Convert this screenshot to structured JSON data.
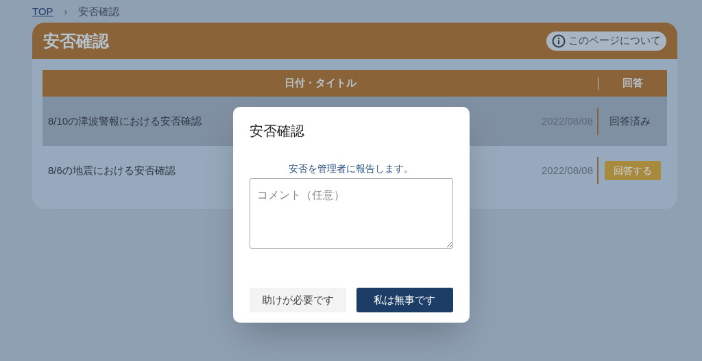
{
  "breadcrumb": {
    "items": [
      {
        "label": "TOP",
        "kind": "link"
      },
      {
        "label": "安否確認",
        "kind": "current"
      }
    ],
    "separator": "›"
  },
  "page": {
    "title": "安否確認",
    "about_button": "このページについて"
  },
  "table": {
    "columns": [
      "日付・タイトル",
      "回答"
    ],
    "rows": [
      {
        "title": "8/10の津波警報における安否確認",
        "date": "2022/08/08",
        "answer": "回答済み",
        "kind": "text",
        "selected": true
      },
      {
        "title": "8/6の地震における安否確認",
        "date": "2022/08/08",
        "answer": "回答する",
        "kind": "button",
        "selected": false
      }
    ]
  },
  "dialog": {
    "title": "安否確認",
    "message": "安否を管理者に報告します。",
    "comment": {
      "placeholder": "コメント（任意）"
    },
    "buttons": [
      {
        "label": "助けが必要です",
        "kind": "secondary"
      },
      {
        "label": "私は無事です",
        "kind": "primary"
      }
    ]
  }
}
